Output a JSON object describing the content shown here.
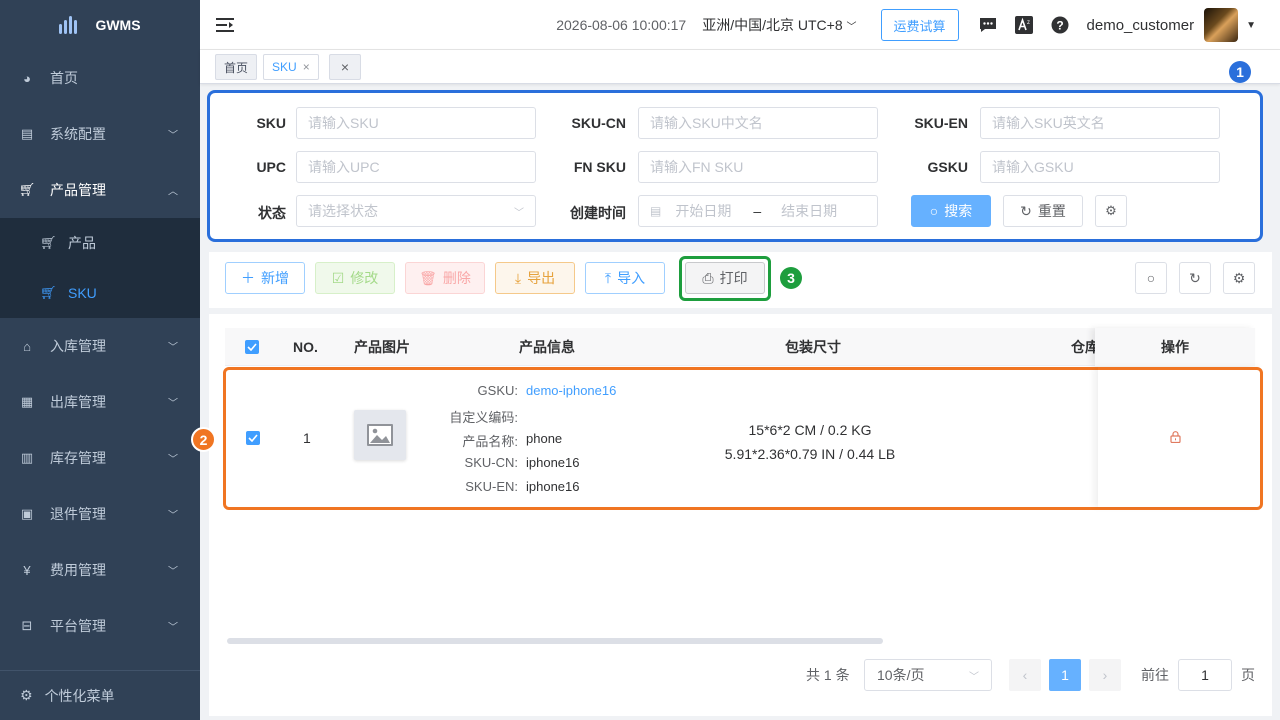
{
  "app": {
    "title": "GWMS"
  },
  "sidebar": {
    "items": [
      {
        "label": "首页",
        "icon": "dashboard-icon"
      },
      {
        "label": "系统配置",
        "icon": "settings-icon"
      },
      {
        "label": "产品管理",
        "icon": "cart-icon"
      },
      {
        "label": "入库管理",
        "icon": "home-icon"
      },
      {
        "label": "出库管理",
        "icon": "grid-icon"
      },
      {
        "label": "库存管理",
        "icon": "table-icon"
      },
      {
        "label": "退件管理",
        "icon": "return-icon"
      },
      {
        "label": "费用管理",
        "icon": "yen-icon"
      },
      {
        "label": "平台管理",
        "icon": "platform-icon"
      }
    ],
    "sub_items": [
      {
        "label": "产品"
      },
      {
        "label": "SKU"
      }
    ],
    "footer": "个性化菜单"
  },
  "header": {
    "datetime": "2026-08-06 10:00:17",
    "timezone": "亚洲/中国/北京 UTC+8",
    "freight_button": "运费试算",
    "username": "demo_customer"
  },
  "tags": [
    {
      "label": "首页"
    },
    {
      "label": "SKU"
    },
    {
      "label": "×"
    }
  ],
  "search": {
    "sku_label": "SKU",
    "sku_placeholder": "请输入SKU",
    "skucn_label": "SKU-CN",
    "skucn_placeholder": "请输入SKU中文名",
    "skuen_label": "SKU-EN",
    "skuen_placeholder": "请输入SKU英文名",
    "upc_label": "UPC",
    "upc_placeholder": "请输入UPC",
    "fnsku_label": "FN SKU",
    "fnsku_placeholder": "请输入FN SKU",
    "gsku_label": "GSKU",
    "gsku_placeholder": "请输入GSKU",
    "status_label": "状态",
    "status_placeholder": "请选择状态",
    "created_label": "创建时间",
    "start_placeholder": "开始日期",
    "range_sep": "–",
    "end_placeholder": "结束日期",
    "search_button": "搜索",
    "reset_button": "重置"
  },
  "toolbar": {
    "add": "新增",
    "edit": "修改",
    "delete": "删除",
    "export": "导出",
    "import": "导入",
    "print": "打印"
  },
  "table": {
    "headers": {
      "no": "NO.",
      "image": "产品图片",
      "info": "产品信息",
      "size": "包装尺寸",
      "warehouse": "仓库",
      "ops": "操作"
    },
    "row": {
      "no": "1",
      "gsku_label": "GSKU:",
      "gsku": "demo-iphone16",
      "custom_label": "自定义编码:",
      "custom": "",
      "name_label": "产品名称:",
      "name": "phone",
      "skucn_label": "SKU-CN:",
      "skucn": "iphone16",
      "skuen_label": "SKU-EN:",
      "skuen": "iphone16",
      "size_metric": "15*6*2 CM / 0.2 KG",
      "size_imperial": "5.91*2.36*0.79 IN / 0.44 LB"
    }
  },
  "pagination": {
    "total": "共 1 条",
    "page_size": "10条/页",
    "current": "1",
    "goto_label": "前往",
    "goto_value": "1",
    "page_unit": "页"
  },
  "annotations": {
    "b1": "1",
    "b2": "2",
    "b3": "3"
  },
  "colors": {
    "sidebar": "#304156",
    "accent": "#409eff",
    "box1": "#2a6fdb",
    "box2": "#f07522",
    "box3": "#1e9e3e"
  }
}
